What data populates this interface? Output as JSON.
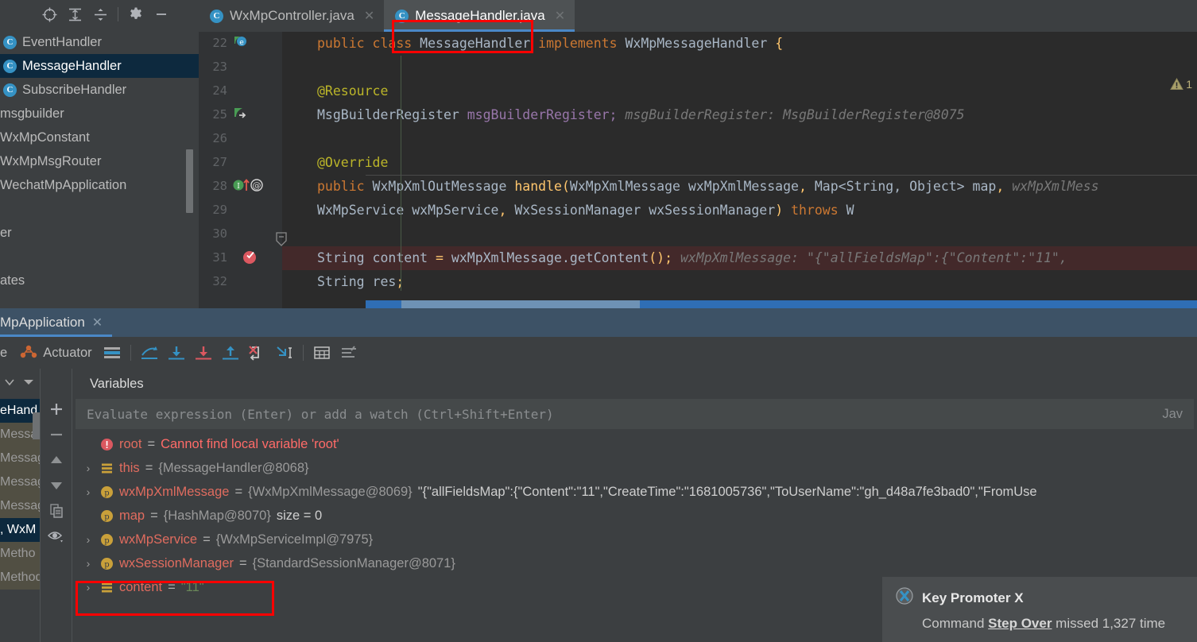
{
  "structure": {
    "toolbar_icons": [
      "locate-icon",
      "expand-all-icon",
      "collapse-all-icon",
      "gear-icon",
      "minimize-icon"
    ],
    "items": [
      {
        "label": "EventHandler",
        "icon": "class-icon",
        "selected": false
      },
      {
        "label": "MessageHandler",
        "icon": "class-icon",
        "selected": true
      },
      {
        "label": "SubscribeHandler",
        "icon": "class-icon",
        "selected": false
      },
      {
        "label": "msgbuilder",
        "icon": "",
        "selected": false
      },
      {
        "label": "WxMpConstant",
        "icon": "",
        "selected": false
      },
      {
        "label": "WxMpMsgRouter",
        "icon": "",
        "selected": false
      },
      {
        "label": "WechatMpApplication",
        "icon": "",
        "selected": false
      }
    ],
    "clipped": [
      "er",
      "ates"
    ]
  },
  "editor": {
    "tabs": [
      {
        "label": "WxMpController.java",
        "icon": "class-icon",
        "active": false
      },
      {
        "label": "MessageHandler.java",
        "icon": "class-icon",
        "active": true
      }
    ],
    "warning_count": "1",
    "lines": [
      {
        "num": "22",
        "gutter": "override-method-icon",
        "exec": false,
        "segments": [
          {
            "t": "public ",
            "c": "kw"
          },
          {
            "t": "class ",
            "c": "kw"
          },
          {
            "t": "MessageHandler ",
            "c": "id"
          },
          {
            "t": "implements ",
            "c": "kw"
          },
          {
            "t": "WxMpMessageHandler ",
            "c": "id"
          },
          {
            "t": "{",
            "c": "mth"
          }
        ]
      },
      {
        "num": "23",
        "gutter": "",
        "exec": false,
        "segments": []
      },
      {
        "num": "24",
        "gutter": "",
        "exec": false,
        "segments": [
          {
            "t": "    @Resource",
            "c": "ann"
          }
        ]
      },
      {
        "num": "25",
        "gutter": "bean-icon",
        "exec": false,
        "segments": [
          {
            "t": "    MsgBuilderRegister ",
            "c": "id"
          },
          {
            "t": "msgBuilderRegister;",
            "c": "fld"
          },
          {
            "t": "   msgBuilderRegister: MsgBuilderRegister@8075",
            "c": "hint"
          }
        ]
      },
      {
        "num": "26",
        "gutter": "",
        "exec": false,
        "segments": []
      },
      {
        "num": "27",
        "gutter": "",
        "exec": false,
        "segments": [
          {
            "t": "    @Override",
            "c": "ann"
          }
        ]
      },
      {
        "num": "28",
        "gutter": "implementing-method-icon",
        "exec": false,
        "segments": [
          {
            "t": "    public ",
            "c": "kw"
          },
          {
            "t": "WxMpXmlOutMessage ",
            "c": "id"
          },
          {
            "t": "handle",
            "c": "mth"
          },
          {
            "t": "(",
            "c": "mth"
          },
          {
            "t": "WxMpXmlMessage wxMpXmlMessage",
            "c": "id"
          },
          {
            "t": ", ",
            "c": "mth"
          },
          {
            "t": "Map<String, Object> map",
            "c": "id"
          },
          {
            "t": ",",
            "c": "mth"
          },
          {
            "t": "   wxMpXmlMess",
            "c": "hint"
          }
        ]
      },
      {
        "num": "29",
        "gutter": "",
        "exec": false,
        "segments": [
          {
            "t": "                              WxMpService wxMpService",
            "c": "id"
          },
          {
            "t": ", ",
            "c": "mth"
          },
          {
            "t": "WxSessionManager wxSessionManager",
            "c": "id"
          },
          {
            "t": ") ",
            "c": "mth"
          },
          {
            "t": "throws ",
            "c": "kw"
          },
          {
            "t": "W",
            "c": "id"
          }
        ]
      },
      {
        "num": "30",
        "gutter": "",
        "exec": false,
        "segments": []
      },
      {
        "num": "31",
        "gutter": "breakpoint-verified-icon",
        "exec": true,
        "segments": [
          {
            "t": "        String content ",
            "c": "id"
          },
          {
            "t": "= ",
            "c": "mth"
          },
          {
            "t": "wxMpXmlMessage.",
            "c": "id"
          },
          {
            "t": "getContent",
            "c": "id"
          },
          {
            "t": "();",
            "c": "mth"
          },
          {
            "t": "   wxMpXmlMessage: \"{\"allFieldsMap\":{\"Content\":\"11\",",
            "c": "hint"
          }
        ]
      },
      {
        "num": "32",
        "gutter": "",
        "exec": false,
        "segments": [
          {
            "t": "        String res",
            "c": "id"
          },
          {
            "t": ";",
            "c": "mth"
          }
        ]
      }
    ]
  },
  "debug": {
    "tab_label": "MpApplication",
    "toolbar": {
      "clipped_label": "e",
      "actuator_label": "Actuator",
      "icons": [
        "layout-icon",
        "step-out-of-icon",
        "step-over-icon",
        "step-into-icon",
        "force-step-into-icon",
        "step-out-icon",
        "drop-frame-icon",
        "run-to-cursor-icon",
        "evaluate-icon",
        "settings-icon"
      ]
    },
    "variables_tab": "Variables",
    "evaluate": {
      "placeholder": "Evaluate expression (Enter) or add a watch (Ctrl+Shift+Enter)",
      "value": "",
      "right_label": "Jav"
    },
    "frames": [
      {
        "label": "eHand",
        "selected": true
      },
      {
        "label": "Messa",
        "selected": false
      },
      {
        "label": "Messag",
        "selected": false
      },
      {
        "label": "Messag",
        "selected": false
      },
      {
        "label": "Messag",
        "selected": false
      },
      {
        "label": ", WxM",
        "selected": true
      },
      {
        "label": "Metho",
        "selected": false
      },
      {
        "label": "Method",
        "selected": false
      }
    ],
    "watch_buttons": [
      "add-watch-icon",
      "remove-watch-icon",
      "move-up-icon",
      "move-down-icon",
      "copy-icon",
      "eye-icon"
    ],
    "variables": [
      {
        "expandable": false,
        "icon": "error-icon",
        "name": "root",
        "eq": "=",
        "value": "Cannot find local variable 'root'",
        "value_kind": "error",
        "extra": "",
        "highlighted": false
      },
      {
        "expandable": true,
        "icon": "object-icon",
        "name": "this",
        "eq": "=",
        "value": "{MessageHandler@8068}",
        "value_kind": "object",
        "extra": "",
        "highlighted": false
      },
      {
        "expandable": true,
        "icon": "param-icon",
        "name": "wxMpXmlMessage",
        "eq": "=",
        "value": "{WxMpXmlMessage@8069}",
        "value_kind": "object",
        "extra": "\"{\"allFieldsMap\":{\"Content\":\"11\",\"CreateTime\":\"1681005736\",\"ToUserName\":\"gh_d48a7fe3bad0\",\"FromUse",
        "highlighted": false
      },
      {
        "expandable": false,
        "icon": "param-icon",
        "name": "map",
        "eq": "=",
        "value": "{HashMap@8070}",
        "value_kind": "object",
        "extra": "size = 0",
        "highlighted": false
      },
      {
        "expandable": true,
        "icon": "param-icon",
        "name": "wxMpService",
        "eq": "=",
        "value": "{WxMpServiceImpl@7975}",
        "value_kind": "object",
        "extra": "",
        "highlighted": false
      },
      {
        "expandable": true,
        "icon": "param-icon",
        "name": "wxSessionManager",
        "eq": "=",
        "value": "{StandardSessionManager@8071}",
        "value_kind": "object",
        "extra": "",
        "highlighted": false
      },
      {
        "expandable": true,
        "icon": "object-icon",
        "name": "content",
        "eq": "=",
        "value": "\"11\"",
        "value_kind": "string",
        "extra": "",
        "highlighted": true
      }
    ]
  },
  "notification": {
    "icon": "key-promoter-x-icon",
    "title": "Key Promoter X",
    "body_prefix": "Command ",
    "body_shortcut": "Step Over",
    "body_suffix": " missed 1,327 time"
  },
  "colors": {
    "accent_blue": "#4a88c7",
    "error_red": "#ff6b68",
    "string_green": "#6a8759",
    "annotation_red": "#ff0000",
    "keyword_orange": "#cc7832",
    "field_purple": "#9876aa",
    "method_yellow": "#ffc66d",
    "exec_line_bg": "#43292a",
    "selection_blue": "#0d293e"
  }
}
